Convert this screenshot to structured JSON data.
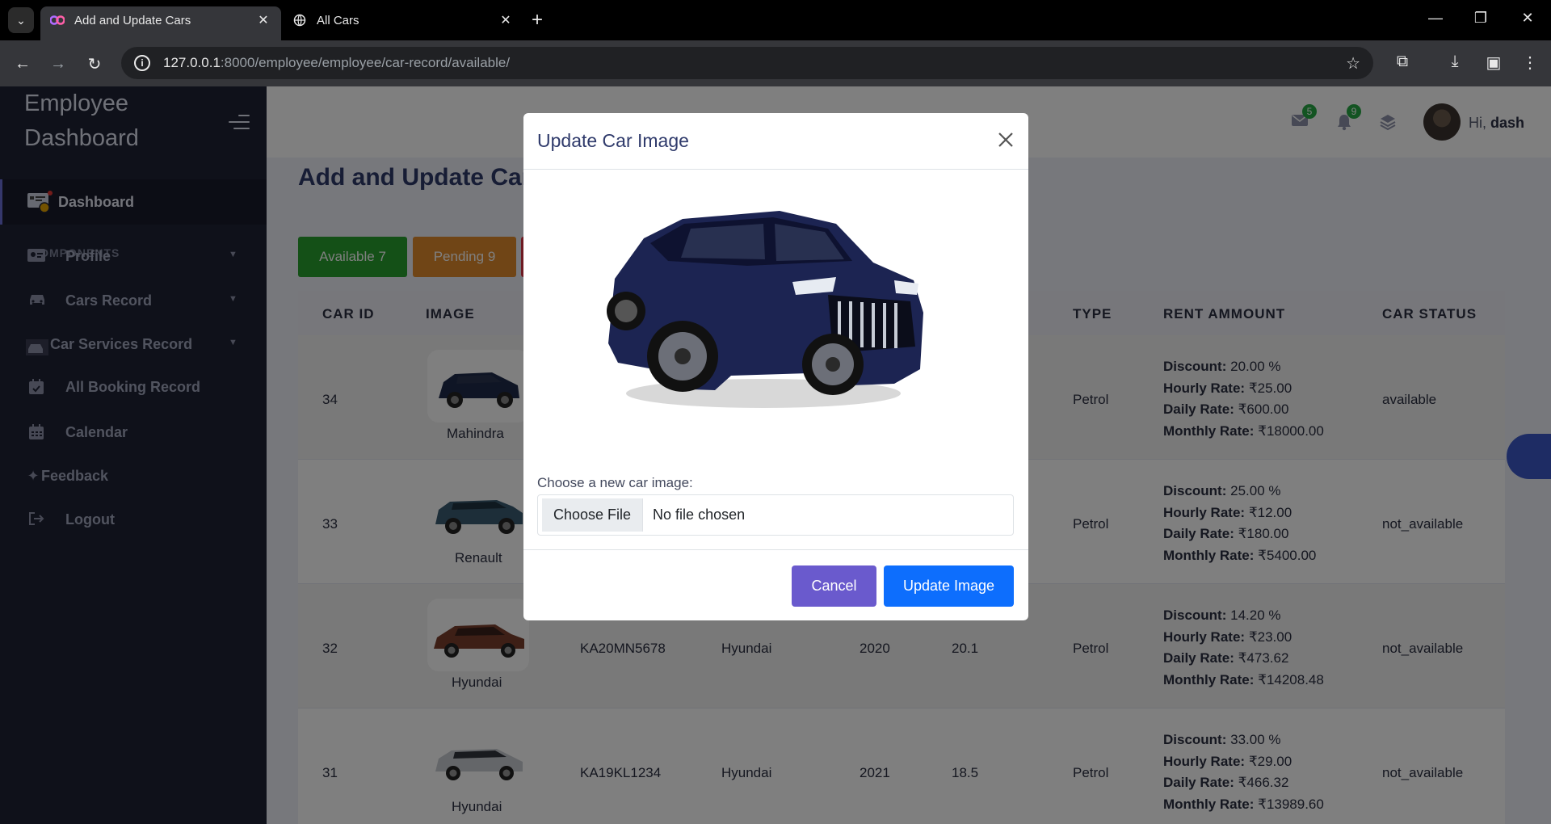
{
  "browser": {
    "tabs": [
      {
        "title": "Add and Update Cars",
        "active": true
      },
      {
        "title": "All Cars",
        "active": false
      }
    ],
    "url_host": "127.0.0.1",
    "url_rest": ":8000/employee/employee/car-record/available/"
  },
  "sidebar": {
    "brand_line1": "Employee",
    "brand_line2": "Dashboard",
    "active_item": "Dashboard",
    "section_label": "COMPONENTS",
    "items": [
      {
        "label": "Profile",
        "icon": "id-card-icon",
        "has_caret": true
      },
      {
        "label": "Cars Record",
        "icon": "car-icon",
        "has_caret": true
      },
      {
        "label": "Car Services Record",
        "icon": "car-service-icon",
        "has_caret": true
      },
      {
        "label": "All Booking Record",
        "icon": "calendar-check-icon",
        "has_caret": false
      },
      {
        "label": "Calendar",
        "icon": "calendar-icon",
        "has_caret": false
      },
      {
        "label": "Feedback",
        "icon": "sparkle-icon",
        "has_caret": false
      },
      {
        "label": "Logout",
        "icon": "logout-icon",
        "has_caret": false
      }
    ]
  },
  "header": {
    "mail_count": "5",
    "notif_count": "9",
    "greeting": "Hi,",
    "username": "dash"
  },
  "main": {
    "title": "Add and Update Cars",
    "stat_buttons": [
      {
        "label": "Available 7",
        "color": "#28a02f"
      },
      {
        "label": "Pending 9",
        "color": "#e08a2c"
      }
    ],
    "columns": {
      "car_id": "CAR ID",
      "image": "IMAGE",
      "type": "TYPE",
      "rent": "RENT AMMOUNT",
      "status": "CAR STATUS"
    },
    "rows": [
      {
        "id": "34",
        "brand": "Mahindra",
        "reg": "",
        "make": "",
        "year": "",
        "mileage": "",
        "type": "Petrol",
        "discount": "20.00 %",
        "hourly": "₹25.00",
        "daily": "₹600.00",
        "monthly": "₹18000.00",
        "status": "available"
      },
      {
        "id": "33",
        "brand": "Renault",
        "reg": "",
        "make": "",
        "year": "",
        "mileage": "",
        "type": "Petrol",
        "discount": "25.00 %",
        "hourly": "₹12.00",
        "daily": "₹180.00",
        "monthly": "₹5400.00",
        "status": "not_available"
      },
      {
        "id": "32",
        "brand": "Hyundai",
        "reg": "KA20MN5678",
        "make": "Hyundai",
        "year": "2020",
        "mileage": "20.1",
        "type": "Petrol",
        "discount": "14.20 %",
        "hourly": "₹23.00",
        "daily": "₹473.62",
        "monthly": "₹14208.48",
        "status": "not_available"
      },
      {
        "id": "31",
        "brand": "Hyundai",
        "reg": "KA19KL1234",
        "make": "Hyundai",
        "year": "2021",
        "mileage": "18.5",
        "type": "Petrol",
        "discount": "33.00 %",
        "hourly": "₹29.00",
        "daily": "₹466.32",
        "monthly": "₹13989.60",
        "status": "not_available"
      }
    ],
    "rent_labels": {
      "discount": "Discount:",
      "hourly": "Hourly Rate:",
      "daily": "Daily Rate:",
      "monthly": "Monthly Rate:"
    }
  },
  "modal": {
    "title": "Update Car Image",
    "file_label": "Choose a new car image:",
    "choose_button": "Choose File",
    "file_status": "No file chosen",
    "cancel_label": "Cancel",
    "update_label": "Update Image"
  }
}
